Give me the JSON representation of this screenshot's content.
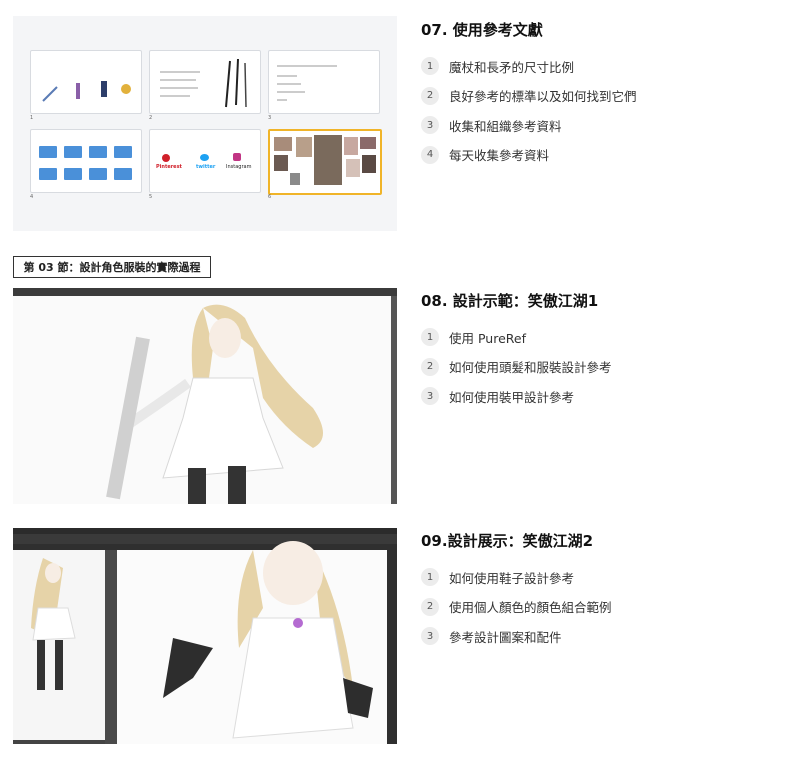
{
  "lessons": [
    {
      "title": "07. 使用參考文獻",
      "items": [
        "魔杖和長矛的尺寸比例",
        "良好參考的標準以及如何找到它們",
        "收集和組織參考資料",
        "每天收集參考資料"
      ]
    },
    {
      "title": "08. 設計示範：笑傲江湖1",
      "items": [
        "使用 PureRef",
        "如何使用頭髮和服裝設計參考",
        "如何使用裝甲設計參考"
      ]
    },
    {
      "title": "09.設計展示：笑傲江湖2",
      "items": [
        "如何使用鞋子設計參考",
        "使用個人顏色的顏色組合範例",
        "參考設計圖案和配件"
      ]
    }
  ],
  "nums": [
    "1",
    "2",
    "3",
    "4"
  ],
  "section_tag": "第 03 節：設計角色服裝的實際過程",
  "slides": {
    "numbers": [
      "1",
      "2",
      "3",
      "4",
      "5",
      "6"
    ],
    "brands": [
      "Pinterest",
      "twitter",
      "Instagram"
    ]
  },
  "colors": {
    "accent": "#f0b429",
    "folder": "#4a90d9"
  }
}
